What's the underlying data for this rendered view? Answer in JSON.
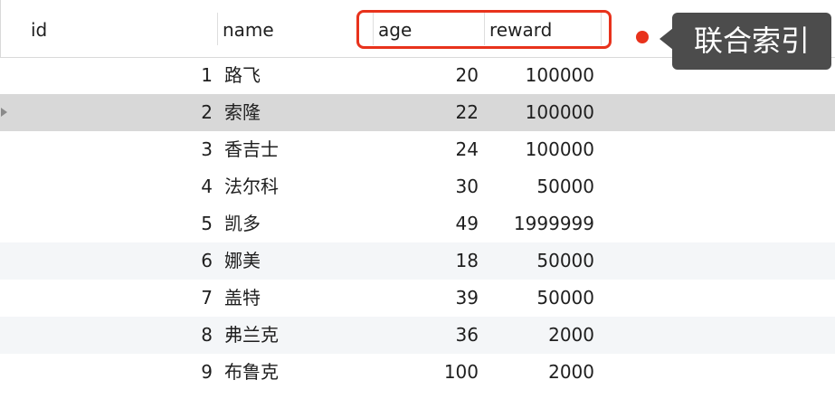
{
  "columns": {
    "id": "id",
    "name": "name",
    "age": "age",
    "reward": "reward"
  },
  "rows": [
    {
      "id": "1",
      "name": "路飞",
      "age": "20",
      "reward": "100000"
    },
    {
      "id": "2",
      "name": "索隆",
      "age": "22",
      "reward": "100000"
    },
    {
      "id": "3",
      "name": "香吉士",
      "age": "24",
      "reward": "100000"
    },
    {
      "id": "4",
      "name": "法尔科",
      "age": "30",
      "reward": "50000"
    },
    {
      "id": "5",
      "name": "凯多",
      "age": "49",
      "reward": "1999999"
    },
    {
      "id": "6",
      "name": "娜美",
      "age": "18",
      "reward": "50000"
    },
    {
      "id": "7",
      "name": "盖特",
      "age": "39",
      "reward": "50000"
    },
    {
      "id": "8",
      "name": "弗兰克",
      "age": "36",
      "reward": "2000"
    },
    {
      "id": "9",
      "name": "布鲁克",
      "age": "100",
      "reward": "2000"
    }
  ],
  "annotation": {
    "label": "联合索引",
    "color": "#e8321c",
    "callout_bg": "#4c4c4c"
  },
  "selected_row": 2,
  "icons": {
    "row_marker": "caret-right-icon"
  }
}
